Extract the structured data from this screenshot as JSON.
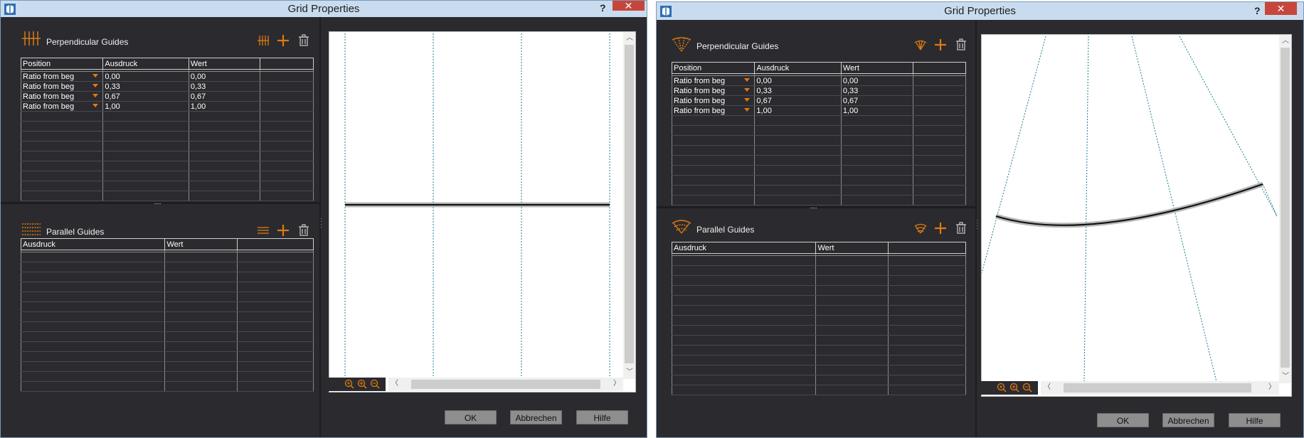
{
  "dialog_a": {
    "title": "Grid Properties",
    "help": "?",
    "close": "✕",
    "perpendicular": {
      "title": "Perpendicular Guides",
      "columns": [
        "Position",
        "Ausdruck",
        "Wert",
        ""
      ],
      "rows": [
        {
          "position": "Ratio from beg",
          "ausdruck": "0,00",
          "wert": "0,00"
        },
        {
          "position": "Ratio from beg",
          "ausdruck": "0,33",
          "wert": "0,33"
        },
        {
          "position": "Ratio from beg",
          "ausdruck": "0,67",
          "wert": "0,67"
        },
        {
          "position": "Ratio from beg",
          "ausdruck": "1,00",
          "wert": "1,00"
        }
      ]
    },
    "parallel": {
      "title": "Parallel Guides",
      "columns": [
        "Ausdruck",
        "Wert",
        ""
      ]
    },
    "buttons": {
      "ok": "OK",
      "cancel": "Abbrechen",
      "help": "Hilfe"
    }
  },
  "dialog_b": {
    "title": "Grid Properties",
    "help": "?",
    "close": "✕",
    "perpendicular": {
      "title": "Perpendicular Guides",
      "columns": [
        "Position",
        "Ausdruck",
        "Wert",
        ""
      ],
      "rows": [
        {
          "position": "Ratio from beg",
          "ausdruck": "0,00",
          "wert": "0,00"
        },
        {
          "position": "Ratio from beg",
          "ausdruck": "0,33",
          "wert": "0,33"
        },
        {
          "position": "Ratio from beg",
          "ausdruck": "0,67",
          "wert": "0,67"
        },
        {
          "position": "Ratio from beg",
          "ausdruck": "1,00",
          "wert": "1,00"
        }
      ]
    },
    "parallel": {
      "title": "Parallel Guides",
      "columns": [
        "Ausdruck",
        "Wert",
        ""
      ]
    },
    "buttons": {
      "ok": "OK",
      "cancel": "Abbrechen",
      "help": "Hilfe"
    }
  },
  "icons": {
    "app": "app-logo-icon",
    "perp_straight": "perpendicular-guides-icon",
    "par_straight": "parallel-guides-icon",
    "perp_curved": "radial-perpendicular-guides-icon",
    "par_curved": "arc-parallel-guides-icon",
    "distribute": "distribute-guides-icon",
    "add": "add-icon",
    "delete": "trash-icon",
    "zoom_fit": "zoom-fit-icon",
    "zoom_in": "zoom-in-icon",
    "zoom_out": "zoom-out-icon"
  },
  "colors": {
    "accent": "#e07a10",
    "panel": "#2b2b2f",
    "titlebar": "#c9dcef",
    "close": "#c7463b",
    "guide": "#1a7f8e"
  }
}
